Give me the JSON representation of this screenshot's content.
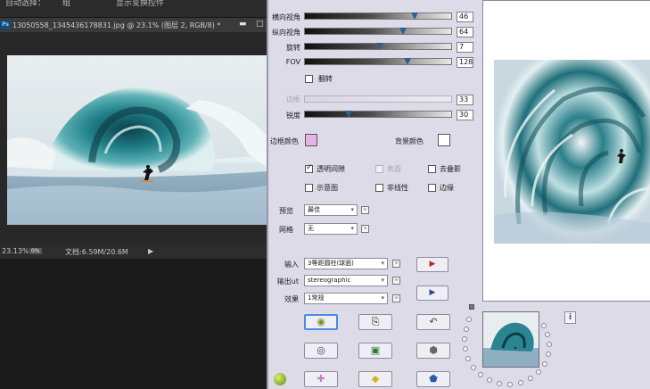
{
  "photoshop": {
    "topbar": {
      "item1": "自动选择：",
      "item2": "组",
      "item3": "显示变换控件"
    },
    "doc_tab": {
      "ps_logo": "Ps",
      "title": "13050558_1345436178831.jpg @ 23.1% (图层 2, RGB/8) *",
      "minimize": "▬",
      "close": "□"
    },
    "status": {
      "zoom": "23.13%",
      "zoom_icon": "0%",
      "doc_size": "文档:6.59M/20.6M",
      "arrow": "▶"
    }
  },
  "panel": {
    "sliders": [
      {
        "label": "横向视角",
        "value": "46",
        "fraction": 0.75,
        "disabled": false
      },
      {
        "label": "纵向视角",
        "value": "64",
        "fraction": 0.67,
        "disabled": false
      },
      {
        "label": "旋转",
        "value": "7",
        "fraction": 0.51,
        "disabled": false
      },
      {
        "label": "FOV",
        "value": "128",
        "fraction": 0.7,
        "disabled": false
      }
    ],
    "flip": {
      "label": "翻转",
      "checked": false
    },
    "sliders2": [
      {
        "label": "边框",
        "value": "33",
        "fraction": 0.0,
        "disabled": true
      },
      {
        "label": "锐度",
        "value": "30",
        "fraction": 0.3,
        "disabled": false
      }
    ],
    "edge_color": {
      "label": "边框颜色",
      "color": "#e7b2e8"
    },
    "bg_color": {
      "label": "背景颜色",
      "color": "#ffffff"
    },
    "checks": [
      {
        "label": "透明间隙",
        "checked": true,
        "disabled": false
      },
      {
        "label": "表面",
        "checked": false,
        "disabled": true
      },
      {
        "label": "去叠影",
        "checked": false,
        "disabled": false
      },
      {
        "label": "示意图",
        "checked": false,
        "disabled": false
      },
      {
        "label": "非线性",
        "checked": false,
        "disabled": false
      },
      {
        "label": "边缘",
        "checked": false,
        "disabled": false
      }
    ],
    "preview_select": {
      "label": "预览",
      "value": "最佳",
      "mini": "∞"
    },
    "grid_select": {
      "label": "网格",
      "value": "无",
      "mini": "∞"
    },
    "input_select": {
      "label": "输入",
      "value": "3等距圆柱(球面)",
      "mini": "∞"
    },
    "output_select": {
      "label": "输出ut",
      "value": "stereographic",
      "mini": "∞"
    },
    "effect_select": {
      "label": "效果",
      "value": "1常规",
      "mini": "∞"
    },
    "buttons": {
      "render_preview": "▶",
      "render_apply": "▶",
      "row1": [
        "◉",
        "⎘",
        "↶"
      ],
      "row2": [
        "◎",
        "▣",
        "⬢"
      ],
      "row3": [
        "✚",
        "◆",
        "⬟"
      ]
    },
    "info": "i",
    "icon_colors": {
      "accent": "#4d8be0",
      "thumb": "#2c5f97"
    }
  }
}
